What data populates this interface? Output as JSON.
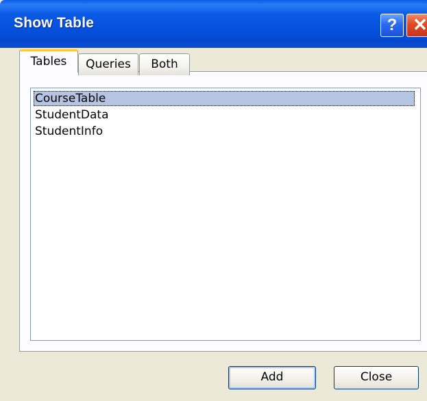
{
  "window": {
    "title": "Show Table",
    "help_glyph": "?",
    "close_glyph": "✕"
  },
  "tabs": [
    {
      "label": "Tables",
      "active": true
    },
    {
      "label": "Queries",
      "active": false
    },
    {
      "label": "Both",
      "active": false
    }
  ],
  "list": {
    "items": [
      "CourseTable",
      "StudentData",
      "StudentInfo"
    ],
    "selected": "CourseTable"
  },
  "buttons": {
    "add_label": "Add",
    "close_label": "Close"
  },
  "colors": {
    "titlebar": "#0650dc",
    "dialog_face": "#ece9d8",
    "selection": "#b5c4e2",
    "active_tab_accent": "#ffc83c"
  }
}
